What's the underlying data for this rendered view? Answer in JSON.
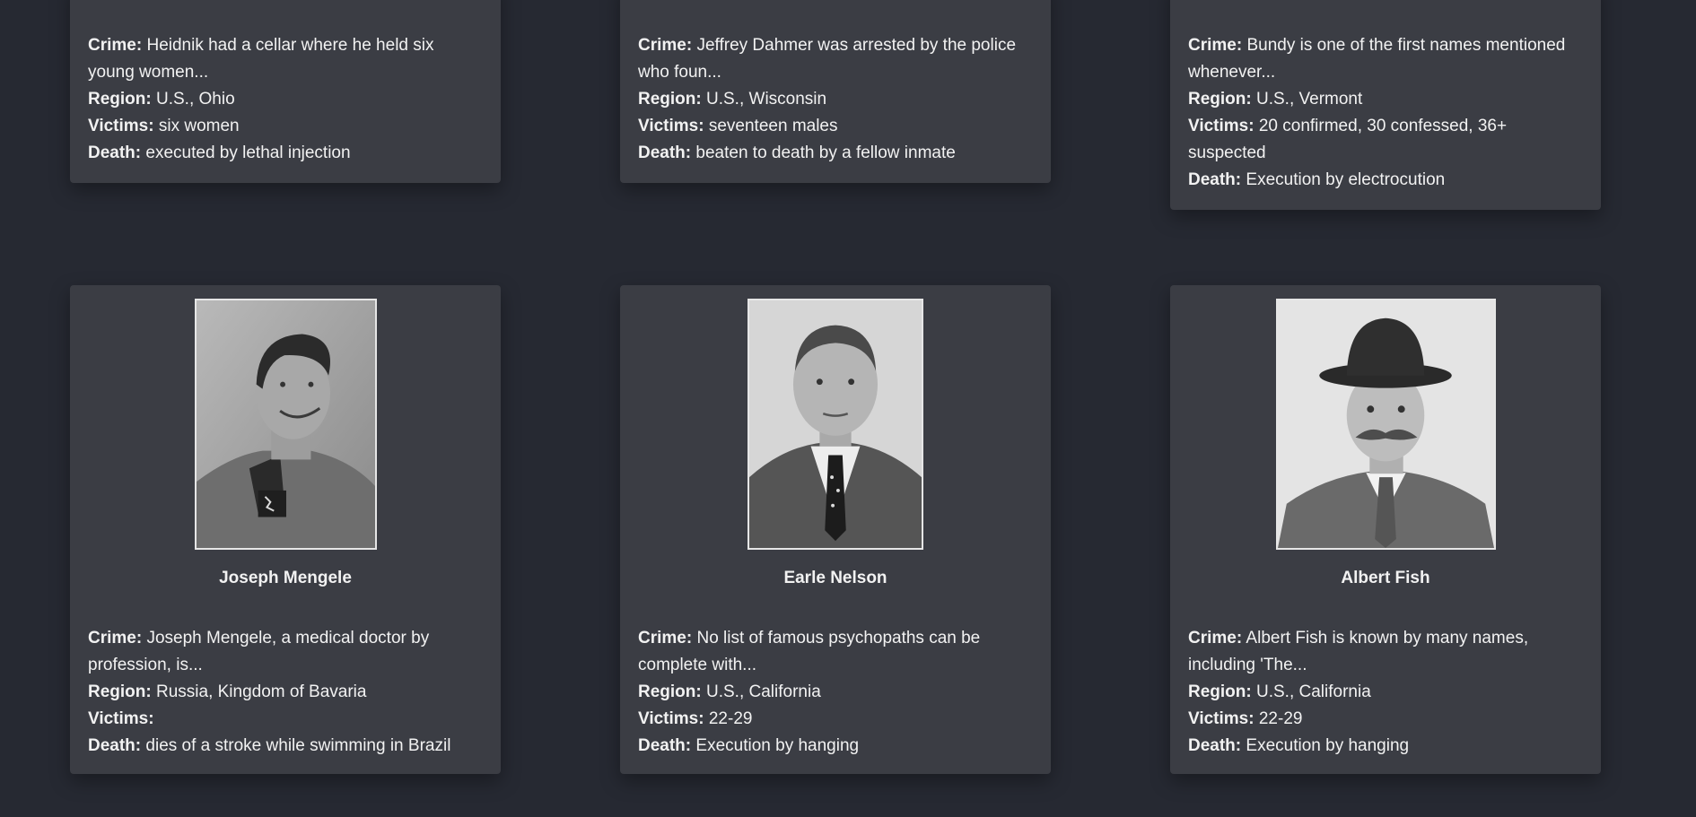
{
  "labels": {
    "crime": "Crime:",
    "region": "Region:",
    "victims": "Victims:",
    "death": "Death:"
  },
  "cards": [
    {
      "crime": "Heidnik had a cellar where he held six young women...",
      "region": "U.S., Ohio",
      "victims": "six women",
      "death": "executed by lethal injection"
    },
    {
      "crime": "Jeffrey Dahmer was arrested by the police who foun...",
      "region": "U.S., Wisconsin",
      "victims": "seventeen males",
      "death": "beaten to death by a fellow inmate"
    },
    {
      "crime": "Bundy is one of the first names mentioned whenever...",
      "region": "U.S., Vermont",
      "victims": "20 confirmed, 30 confessed, 36+ suspected",
      "death": "Execution by electrocution"
    },
    {
      "name": "Joseph Mengele",
      "crime": "Joseph Mengele, a medical doctor by profession, is...",
      "region": "Russia, Kingdom of Bavaria",
      "victims": "",
      "death": "dies of a stroke while swimming in Brazil"
    },
    {
      "name": "Earle Nelson",
      "crime": "No list of famous psychopaths can be complete with...",
      "region": "U.S., California",
      "victims": "22-29",
      "death": "Execution by hanging"
    },
    {
      "name": "Albert Fish",
      "crime": "Albert Fish is known by many names, including 'The...",
      "region": "U.S., California",
      "victims": "22-29",
      "death": "Execution by hanging"
    }
  ],
  "colors": {
    "page_background": "#262932",
    "card_background": "#3b3d44",
    "text": "#f2f2f2",
    "photo_border": "#e6e6e6"
  }
}
